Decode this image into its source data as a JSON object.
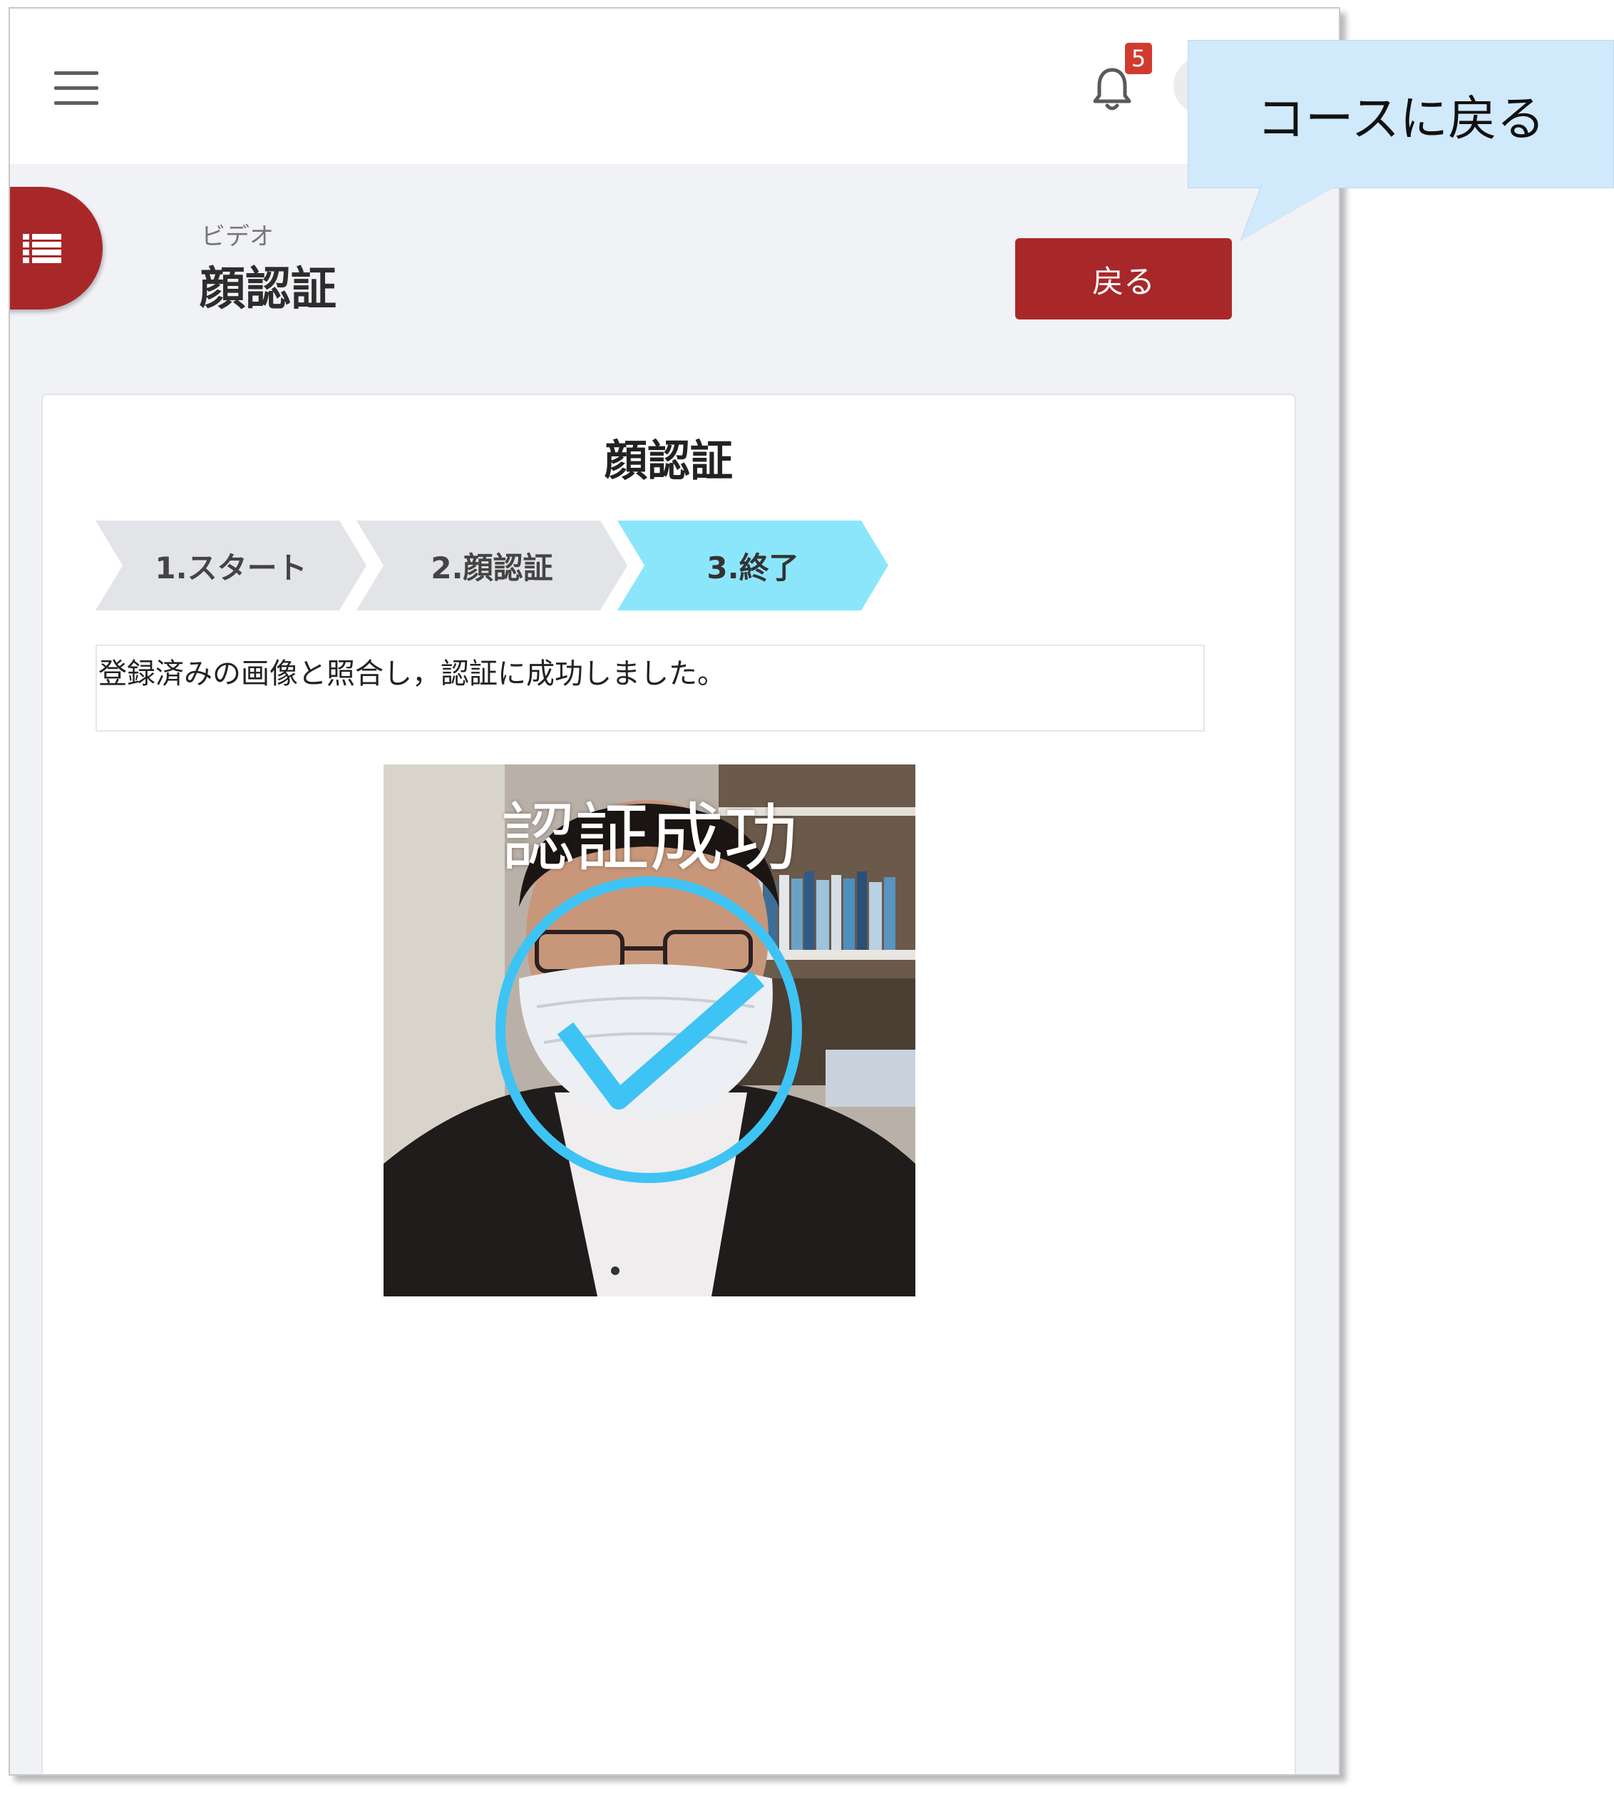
{
  "topbar": {
    "notification_count": "5"
  },
  "header": {
    "subtitle": "ビデオ",
    "title": "顔認証",
    "back_button_label": "戻る"
  },
  "card": {
    "title": "顔認証",
    "steps": [
      {
        "label": "1.スタート",
        "state": "done"
      },
      {
        "label": "2.顔認証",
        "state": "done"
      },
      {
        "label": "3.終了",
        "state": "active"
      }
    ],
    "message": "登録済みの画像と照合し，認証に成功しました。",
    "result_overlay_text": "認証成功"
  },
  "callout": {
    "text": "コースに戻る"
  },
  "colors": {
    "accent_red": "#a8282a",
    "active_step": "#8ce6fb",
    "check_blue": "#3ec3f5",
    "callout_bg": "#d0e9fb"
  },
  "icons": [
    "hamburger-menu-icon",
    "bell-icon",
    "list-icon",
    "checkmark-icon"
  ]
}
